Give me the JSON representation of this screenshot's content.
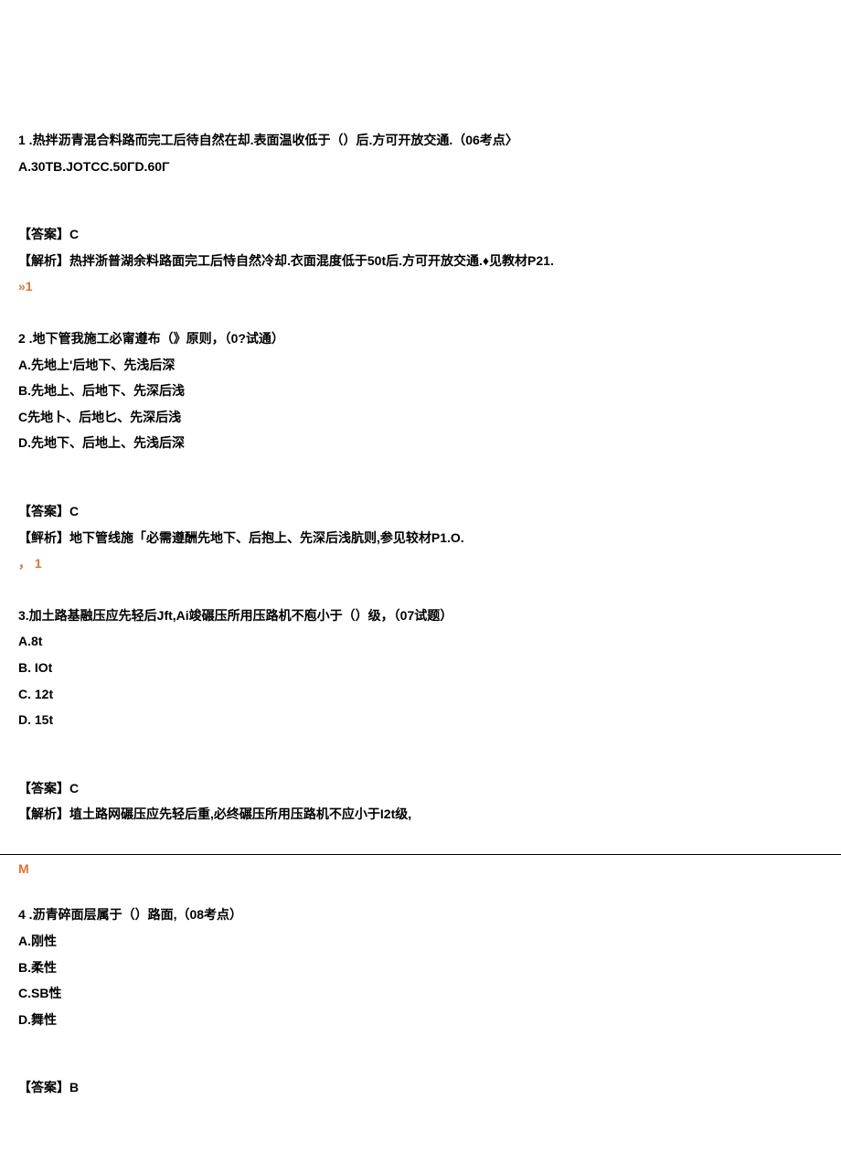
{
  "q1": {
    "text": "1 .热拌沥青混合料路而完工后待自然在却.表面温收低于（）后.方可开放交通.（06考点〉",
    "options_line": "A.30TB.JOTCC.50ΓD.60Γ",
    "answer": "【答案】C",
    "analysis": "【解析】热拌浙普湖余料路面完工后恃自然冷却.衣面混度低于50t后.方可开放交通.♦见教材P21.",
    "marker": "»1"
  },
  "q2": {
    "text": "2 .地下管我施工必甯遵布（》原则，（0?试通）",
    "optA": "A.先地上'后地下、先浅后深",
    "optB": "B.先地上、后地下、先深后浅",
    "optC": "C先地卜、后地匕、先深后浅",
    "optD": "D.先地下、后地上、先浅后深",
    "answer": "【答案】C",
    "analysis": "【鲆析】地下管线施「必需遵酬先地下、后抱上、先深后浅肮则,参见较材P1.O.",
    "marker": "， 1"
  },
  "q3": {
    "text": "3.加土路基融压应先轻后Jft,Ai竣碾压所用压路机不庖小于（）级，（07试题）",
    "optA": "A.8t",
    "optB": "B.   IOt",
    "optC": "C.   12t",
    "optD": "D.   15t",
    "answer": "【答案】C",
    "analysis": "【解析】埴土路网碾压应先轻后重,必终碾压所用压路机不应小于I2t级,",
    "marker": "M"
  },
  "q4": {
    "text": "4 .沥青碎面层属于（）路面,（08考点）",
    "optA": "A.刚性",
    "optB": "B.柔性",
    "optC": "C.SB性",
    "optD": "D.舞性",
    "answer": "【答案】B"
  }
}
